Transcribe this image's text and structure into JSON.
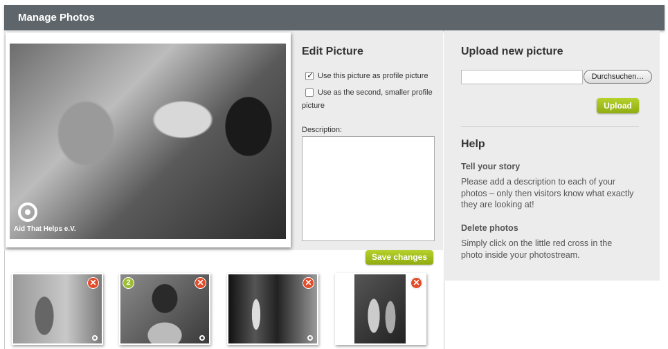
{
  "header": {
    "title": "Manage Photos"
  },
  "main_photo": {
    "logo_text": "Aid That Helps e.V."
  },
  "edit": {
    "title": "Edit Picture",
    "profile_checkbox_label": "Use this picture as profile picture",
    "profile_checked": true,
    "second_checkbox_label_line1": "Use as the second, smaller profile",
    "second_checkbox_label_line2": "picture",
    "second_checked": false,
    "description_label": "Description:",
    "description_value": "",
    "save_label": "Save changes"
  },
  "upload": {
    "title": "Upload new picture",
    "browse_label": "Durchsuchen…",
    "upload_label": "Upload"
  },
  "help": {
    "title": "Help",
    "story_heading": "Tell your story",
    "story_text": "Please add a description to each of your photos – only then visitors know what exactly they are looking at!",
    "delete_heading": "Delete photos",
    "delete_text": "Simply click on the little red cross in the photo inside your photostream."
  },
  "photostream": {
    "delete_glyph": "✕",
    "badge_number": "2"
  },
  "colors": {
    "header_bg": "#5f666b",
    "accent_green": "#9cbd34",
    "delete_red": "#e24c2a",
    "panel_bg": "#ececec"
  }
}
